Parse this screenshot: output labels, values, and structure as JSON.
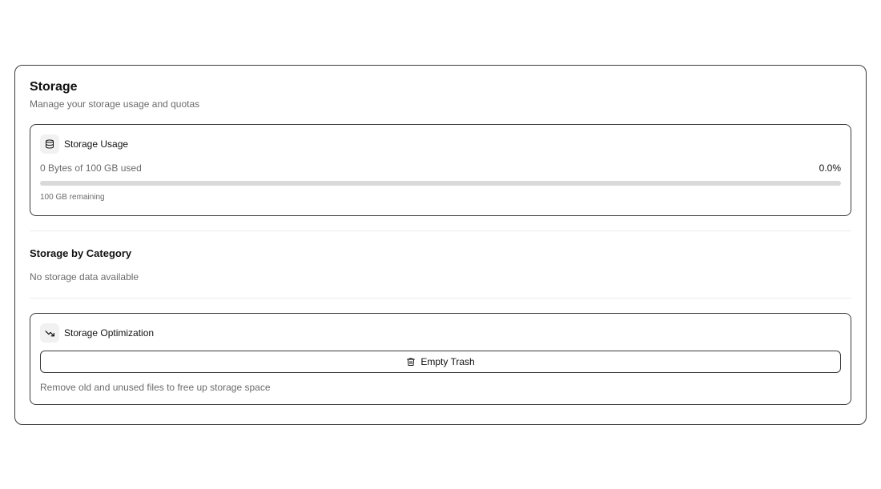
{
  "page": {
    "title": "Storage",
    "subtitle": "Manage your storage usage and quotas"
  },
  "usage": {
    "title": "Storage Usage",
    "icon": "database-icon",
    "used_text": "0 Bytes of 100 GB used",
    "percent_text": "0.0%",
    "progress": 0.0,
    "remaining_text": "100 GB remaining"
  },
  "category": {
    "title": "Storage by Category",
    "empty_text": "No storage data available"
  },
  "optimization": {
    "title": "Storage Optimization",
    "icon": "trending-down-icon",
    "button_label": "Empty Trash",
    "button_icon": "trash-icon",
    "hint": "Remove old and unused files to free up storage space"
  }
}
